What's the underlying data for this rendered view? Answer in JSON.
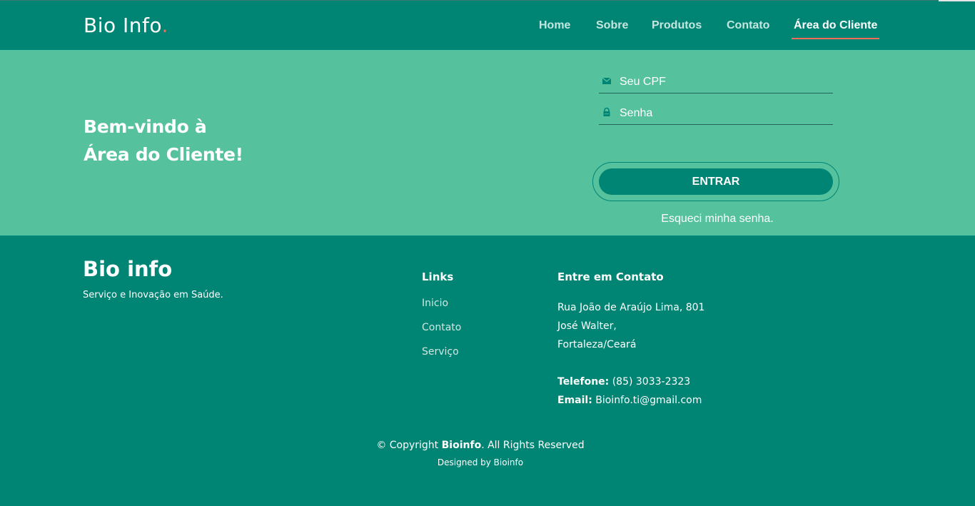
{
  "header": {
    "logo": "Bio Info",
    "logo_dot": ".",
    "nav": [
      {
        "label": "Home"
      },
      {
        "label": "Sobre"
      },
      {
        "label": "Produtos"
      },
      {
        "label": "Contato"
      },
      {
        "label": "Área do Cliente",
        "active": true
      }
    ]
  },
  "hero": {
    "welcome_line1": "Bem-vindo à",
    "welcome_line2": "Área do Cliente!",
    "cpf_placeholder": "Seu CPF",
    "password_placeholder": "Senha",
    "submit_label": "ENTRAR",
    "forgot_label": "Esqueci minha senha."
  },
  "footer": {
    "brand": "Bio info",
    "tagline": "Serviço e Inovação em Saúde.",
    "links_heading": "Links",
    "links": [
      "Inicio",
      "Contato",
      "Serviço"
    ],
    "contact_heading": "Entre em Contato",
    "address_line1": "Rua João de Araújo Lima, 801",
    "address_line2": "José Walter,",
    "address_line3": "Fortaleza/Ceará",
    "phone_label": "Telefone:",
    "phone_value": "(85) 3033-2323",
    "email_label": "Email:",
    "email_value": "Bioinfo.ti@gmail.com",
    "copyright_prefix": "© Copyright",
    "copyright_brand": "Bioinfo",
    "copyright_suffix": ". All Rights Reserved",
    "designed_by": "Designed by Bioinfo"
  },
  "colors": {
    "primary": "#008474",
    "hero_bg": "#55c29d",
    "accent": "#ff6b57"
  },
  "icons": {
    "cpf_field": "envelope-icon",
    "password_field": "lock-icon"
  }
}
